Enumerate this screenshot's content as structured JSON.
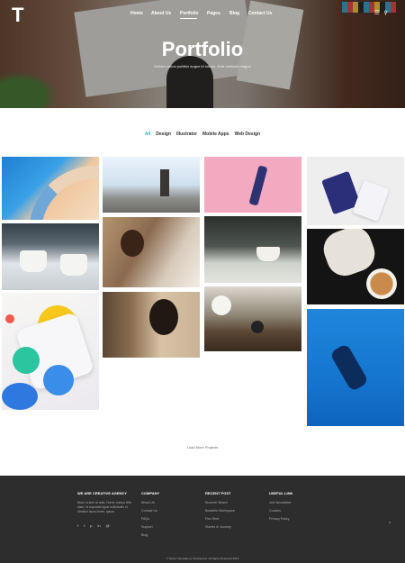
{
  "header": {
    "logo": "T",
    "nav": [
      {
        "label": "Home",
        "active": false
      },
      {
        "label": "About Us",
        "active": false
      },
      {
        "label": "Portfolio",
        "active": true
      },
      {
        "label": "Pages",
        "active": false
      },
      {
        "label": "Blog",
        "active": false
      },
      {
        "label": "Contact Us",
        "active": false
      }
    ],
    "icons": [
      "menu-icon",
      "search-icon"
    ]
  },
  "hero": {
    "title": "Portfolio",
    "subtitle": "Nullam varius porttitor augue id rutrum. Duis vehicula magna"
  },
  "filters": [
    {
      "label": "All",
      "active": true
    },
    {
      "label": "Design",
      "active": false
    },
    {
      "label": "Illustrator",
      "active": false
    },
    {
      "label": "Mobile Apps",
      "active": false
    },
    {
      "label": "Web Design",
      "active": false
    }
  ],
  "load_more": "Load More Projects",
  "footer": {
    "about": {
      "title": "WE ARE CREATIVE AGENCY",
      "text": "Nunc ut sem at ante, Donec cursus felis diam, id vulputate ligula sollicitudin et. Vestibul lacus lorem, ipsum.",
      "socials": [
        "f",
        "t",
        "p",
        "in",
        "@"
      ]
    },
    "company": {
      "title": "COMPANY",
      "links": [
        "About Us",
        "Contact Us",
        "FAQs",
        "Support",
        "Blog"
      ]
    },
    "recent_post": {
      "title": "RECENT POST",
      "links": [
        "Summer Beach",
        "Beautiful Workspace",
        "Flex Shirt",
        "Stories in Journey"
      ]
    },
    "useful_link": {
      "title": "USEFUL LINK",
      "links": [
        "Join Newsletter",
        "Cookies",
        "Privacy Policy"
      ]
    },
    "copyright": "© Starter Template by DuckSports. All Rights Reserved 2019",
    "to_top": "^"
  },
  "colors": {
    "accent": "#27b3c6",
    "footer_bg": "#2d2d2d"
  }
}
